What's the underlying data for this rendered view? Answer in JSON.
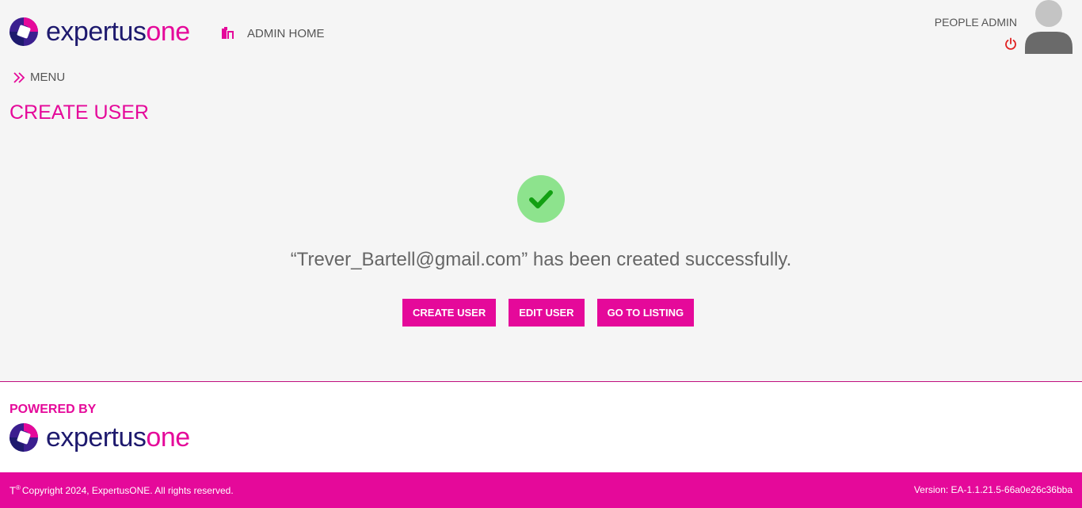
{
  "brand": {
    "name_part1": "expertus",
    "name_part2": "one"
  },
  "header": {
    "home_link": "ADMIN HOME",
    "user_role": "PEOPLE ADMIN",
    "icons": {
      "home": "home-icon",
      "power": "power-icon",
      "avatar": "avatar-icon"
    }
  },
  "menu": {
    "label": "MENU",
    "icon": "double-chevron-right-icon"
  },
  "page": {
    "title": "CREATE USER"
  },
  "result": {
    "icon": "check-circle-icon",
    "message": "“Trever_Bartell@gmail.com” has been created successfully."
  },
  "actions": {
    "create_user": "CREATE USER",
    "edit_user": "EDIT USER",
    "go_to_listing": "GO TO LISTING"
  },
  "footer": {
    "powered_by": "POWERED BY",
    "tm_symbol": "T",
    "tm_super": "®",
    "copyright": "Copyright 2024, ExpertusONE. All rights reserved.",
    "version": "Version: EA-1.1.21.5-66a0e26c36bba"
  },
  "colors": {
    "accent": "#e5099a",
    "brand_navy": "#1e1a6e",
    "success_bg": "#8de38d",
    "success_check": "#12a012",
    "power_red": "#e02020"
  }
}
